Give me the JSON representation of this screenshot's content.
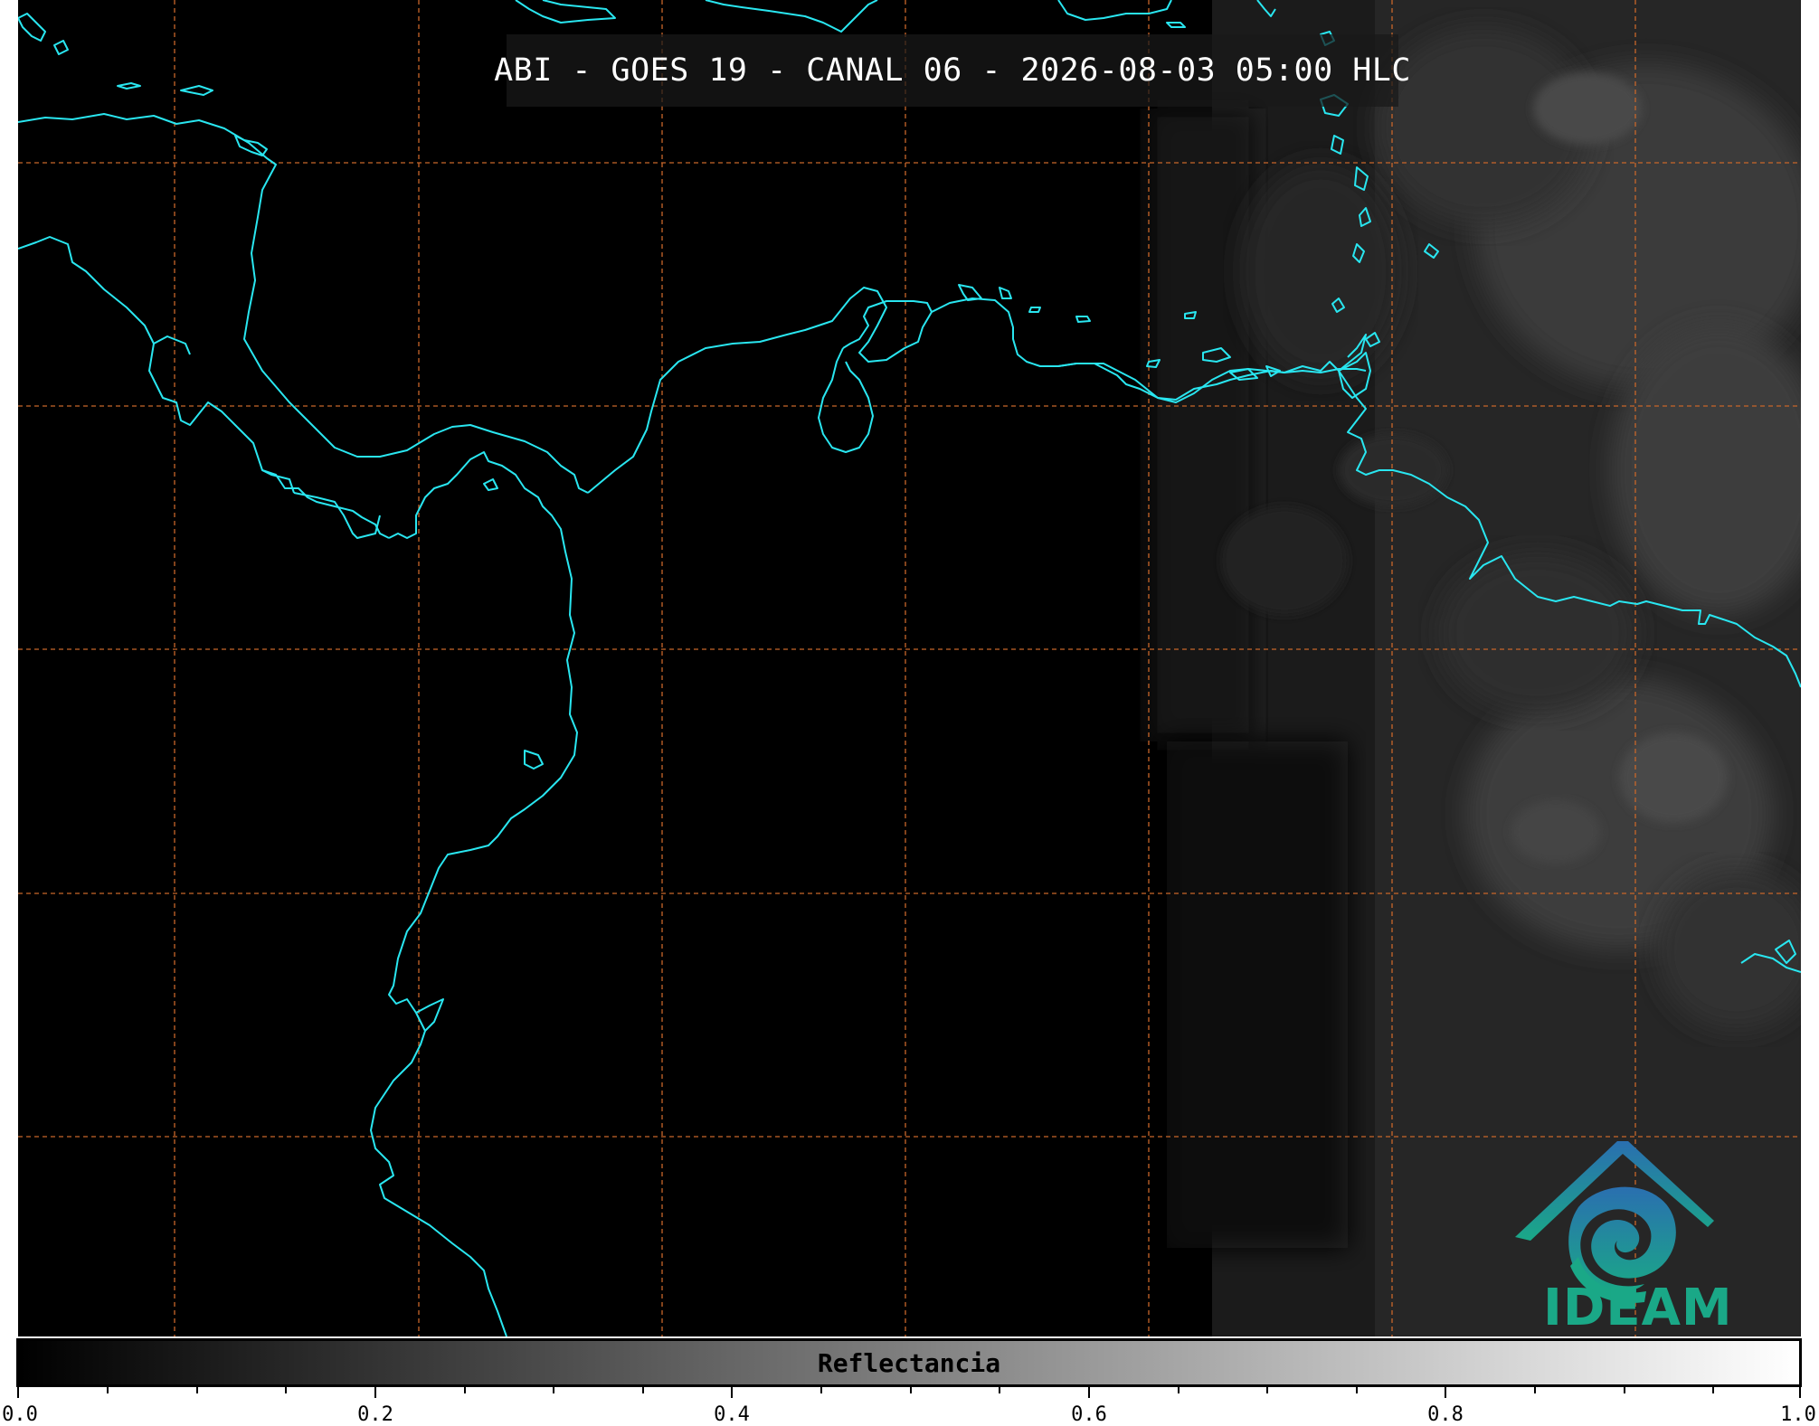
{
  "title": "ABI - GOES 19 - CANAL 06 - 2026-08-03 05:00 HLC",
  "colorbar": {
    "label": "Reflectancia",
    "ticks": [
      "0.0",
      "0.2",
      "0.4",
      "0.6",
      "0.8",
      "1.0"
    ],
    "min": 0.0,
    "max": 1.0,
    "colormap": [
      "#000000",
      "#ffffff"
    ]
  },
  "logo": {
    "text": "IDEAM",
    "colors": [
      "#2a6fb0",
      "#1aa887"
    ]
  },
  "colors": {
    "coastline": "#29e6f0",
    "gridlines": "#c8662a",
    "background": "#000000"
  }
}
